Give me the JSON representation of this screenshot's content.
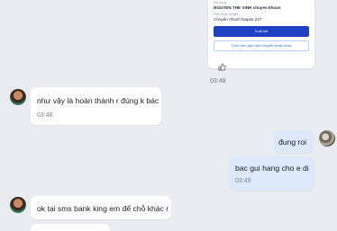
{
  "transfer_card": {
    "receiver_label": "Nội dung",
    "receiver_name": "NGUYEN THE VINH chuyen khoan",
    "method_label": "Hình thức chuyển",
    "method_value": "Chuyển nhanh Napas 247",
    "primary_button": "Xuất thẻ",
    "secondary_button": "Thực hiện giao dịch chuyển khoản khác"
  },
  "messages": [
    {
      "id": "m1",
      "direction": "out",
      "time": "03:48"
    },
    {
      "id": "m2",
      "direction": "in",
      "text": "như vậy là hoàn thành r đúng k bác",
      "time": "03:48"
    },
    {
      "id": "m3",
      "direction": "out",
      "text": "đung roi"
    },
    {
      "id": "m4",
      "direction": "out",
      "text": "bac gui hang cho e di",
      "time": "03:49"
    },
    {
      "id": "m5",
      "direction": "in",
      "text": "ok tại sms bank king em để chỗ khác r"
    }
  ],
  "colors": {
    "background": "#e9ecf1",
    "incoming_bubble": "#ffffff",
    "outgoing_bubble": "#dde8fb",
    "accent": "#2041c4"
  },
  "icons": {
    "reaction": "thumbs-up-icon"
  }
}
